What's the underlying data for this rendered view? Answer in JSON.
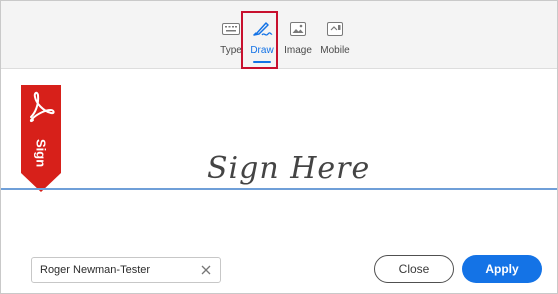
{
  "tabs": [
    {
      "id": "type",
      "label": "Type",
      "icon": "keyboard-icon"
    },
    {
      "id": "draw",
      "label": "Draw",
      "icon": "pen-draw-icon",
      "active": true
    },
    {
      "id": "image",
      "label": "Image",
      "icon": "image-icon"
    },
    {
      "id": "mobile",
      "label": "Mobile",
      "icon": "mobile-icon"
    }
  ],
  "canvas": {
    "ribbon_text": "Sign",
    "placeholder": "Sign Here"
  },
  "name_field": {
    "value": "Roger Newman-Tester"
  },
  "buttons": {
    "close_label": "Close",
    "apply_label": "Apply"
  },
  "colors": {
    "accent": "#1473e6",
    "ribbon": "#d7201a",
    "highlight": "#c8102e"
  }
}
